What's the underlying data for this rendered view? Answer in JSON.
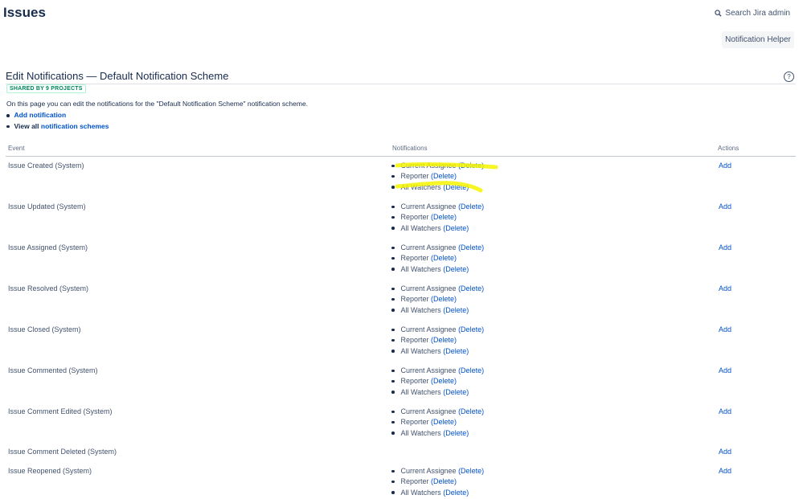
{
  "header": {
    "title": "Issues",
    "search_label": "Search Jira admin",
    "helper_button": "Notification Helper"
  },
  "scheme": {
    "title": "Edit Notifications — Default Notification Scheme",
    "shared_badge": "SHARED BY 9 PROJECTS",
    "help_icon": "help-icon",
    "intro": "On this page you can edit the notifications for the \"Default Notification Scheme\" notification scheme.",
    "add_notification": "Add notification",
    "view_all_prefix": "View all",
    "view_all_link": "notification schemes"
  },
  "table": {
    "columns": [
      "Event",
      "Notifications",
      "Actions"
    ],
    "delete_label": "(Delete)",
    "add_label": "Add",
    "rows": [
      {
        "event": "Issue Created (System)",
        "notifications": [
          "Current Assignee",
          "Reporter",
          "All Watchers"
        ]
      },
      {
        "event": "Issue Updated (System)",
        "notifications": [
          "Current Assignee",
          "Reporter",
          "All Watchers"
        ]
      },
      {
        "event": "Issue Assigned (System)",
        "notifications": [
          "Current Assignee",
          "Reporter",
          "All Watchers"
        ]
      },
      {
        "event": "Issue Resolved (System)",
        "notifications": [
          "Current Assignee",
          "Reporter",
          "All Watchers"
        ]
      },
      {
        "event": "Issue Closed (System)",
        "notifications": [
          "Current Assignee",
          "Reporter",
          "All Watchers"
        ]
      },
      {
        "event": "Issue Commented (System)",
        "notifications": [
          "Current Assignee",
          "Reporter",
          "All Watchers"
        ]
      },
      {
        "event": "Issue Comment Edited (System)",
        "notifications": [
          "Current Assignee",
          "Reporter",
          "All Watchers"
        ]
      },
      {
        "event": "Issue Comment Deleted (System)",
        "notifications": []
      },
      {
        "event": "Issue Reopened (System)",
        "notifications": [
          "Current Assignee",
          "Reporter",
          "All Watchers"
        ]
      }
    ]
  },
  "colors": {
    "link": "#0052cc",
    "highlight": "#f5f500",
    "badge": "#00875a"
  }
}
